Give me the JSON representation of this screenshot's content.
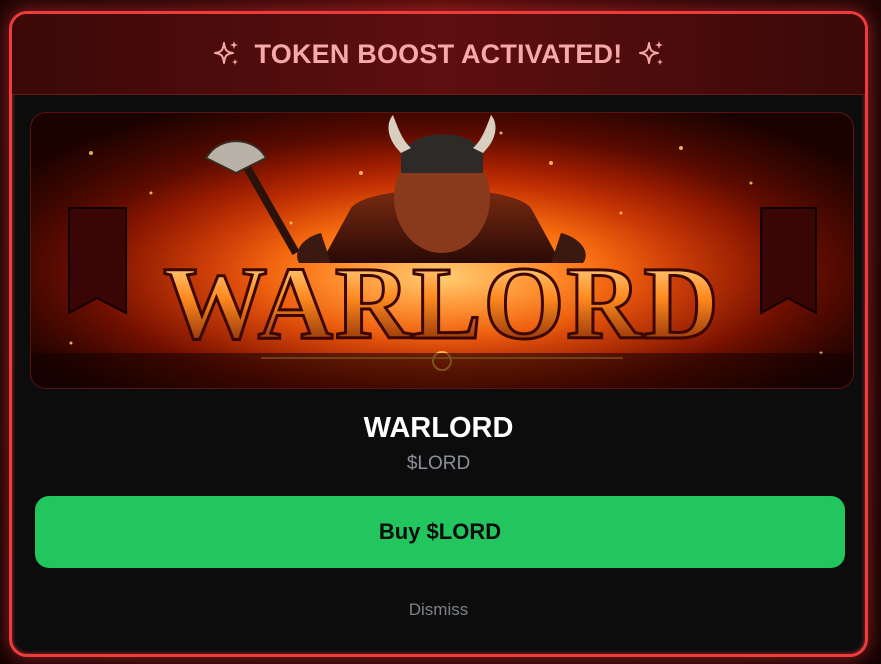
{
  "header": {
    "title": "TOKEN BOOST ACTIVATED!",
    "left_icon": "sparkles-icon",
    "right_icon": "sparkles-icon",
    "accent_color": "#ef3b3b",
    "title_color": "#f7a8a8"
  },
  "banner": {
    "image_text": "WARLORD",
    "description": "warlord-banner-image"
  },
  "token": {
    "name": "WARLORD",
    "symbol": "$LORD"
  },
  "actions": {
    "buy_label": "Buy $LORD",
    "buy_color": "#22c55e",
    "dismiss_label": "Dismiss"
  }
}
